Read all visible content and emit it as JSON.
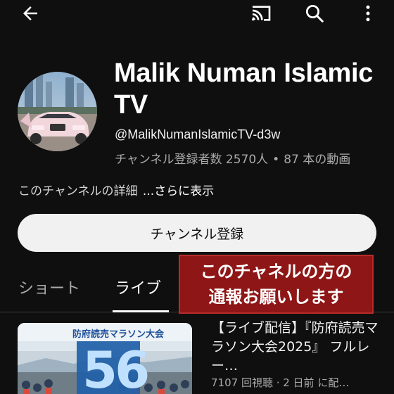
{
  "channel": {
    "title_line1": "Malik Numan Islamic",
    "title_line2": "TV",
    "handle": "@MalikNumanIslamicTV-d3w",
    "subscribers": "チャンネル登録者数 2570人",
    "separator": "•",
    "video_count": "87 本の動画",
    "description": "このチャンネルの詳細",
    "more_link": "...さらに表示",
    "subscribe_label": "チャンネル登録"
  },
  "tabs": [
    {
      "label": "ショート",
      "selected": false
    },
    {
      "label": "ライブ",
      "selected": true
    }
  ],
  "banner": {
    "line1": "このチャネルの方の",
    "line2": "通報お願いします"
  },
  "video": {
    "title": "【ライブ配信】『防府読売マラソン大会2025』 フルレー…",
    "meta": "7107 回視聴 · 2 日前 に配…",
    "thumb_header": "防府読売マラソン大会",
    "thumb_number": "56"
  },
  "icons": {
    "back": "arrow-back-icon",
    "cast": "cast-icon",
    "search": "search-icon",
    "more": "more-vert-icon"
  },
  "colors": {
    "background": "#0f0f0f",
    "banner": "#8e1616",
    "subscribe_bg": "#f1f1f1"
  }
}
